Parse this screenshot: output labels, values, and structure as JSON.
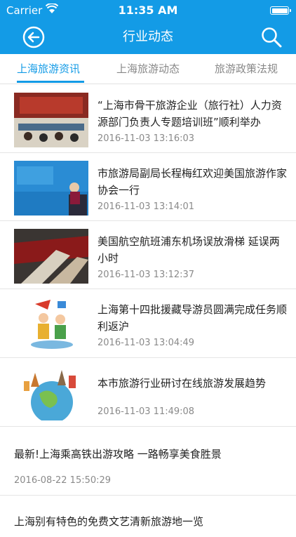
{
  "status_bar": {
    "carrier": "Carrier",
    "time": "11:35 AM"
  },
  "nav": {
    "title": "行业动态"
  },
  "tabs": [
    {
      "label": "上海旅游资讯",
      "active": true
    },
    {
      "label": "上海旅游动态",
      "active": false
    },
    {
      "label": "旅游政策法规",
      "active": false
    }
  ],
  "articles": [
    {
      "title": "“上海市骨干旅游企业（旅行社）人力资源部门负责人专题培训班”顺利举办",
      "time": "2016-11-03 13:16:03"
    },
    {
      "title": "市旅游局副局长程梅红欢迎美国旅游作家协会一行",
      "time": "2016-11-03 13:14:01"
    },
    {
      "title": "美国航空航班浦东机场误放滑梯 延误两小时",
      "time": "2016-11-03 13:12:37"
    },
    {
      "title": "上海第十四批援藏导游员圆满完成任务顺利返沪",
      "time": "2016-11-03 13:04:49"
    },
    {
      "title": "本市旅游行业研讨在线旅游发展趋势",
      "time": "2016-11-03 11:49:08"
    },
    {
      "title": "最新!上海乘高铁出游攻略 一路畅享美食胜景",
      "time": "2016-08-22 15:50:29"
    },
    {
      "title": "上海别有特色的免费文艺清新旅游地一览"
    }
  ],
  "colors": {
    "accent": "#139be6",
    "text": "#222222",
    "muted": "#8a8a8a"
  },
  "icons": [
    "wifi-icon",
    "back-arrow-icon",
    "search-icon",
    "battery-icon"
  ]
}
